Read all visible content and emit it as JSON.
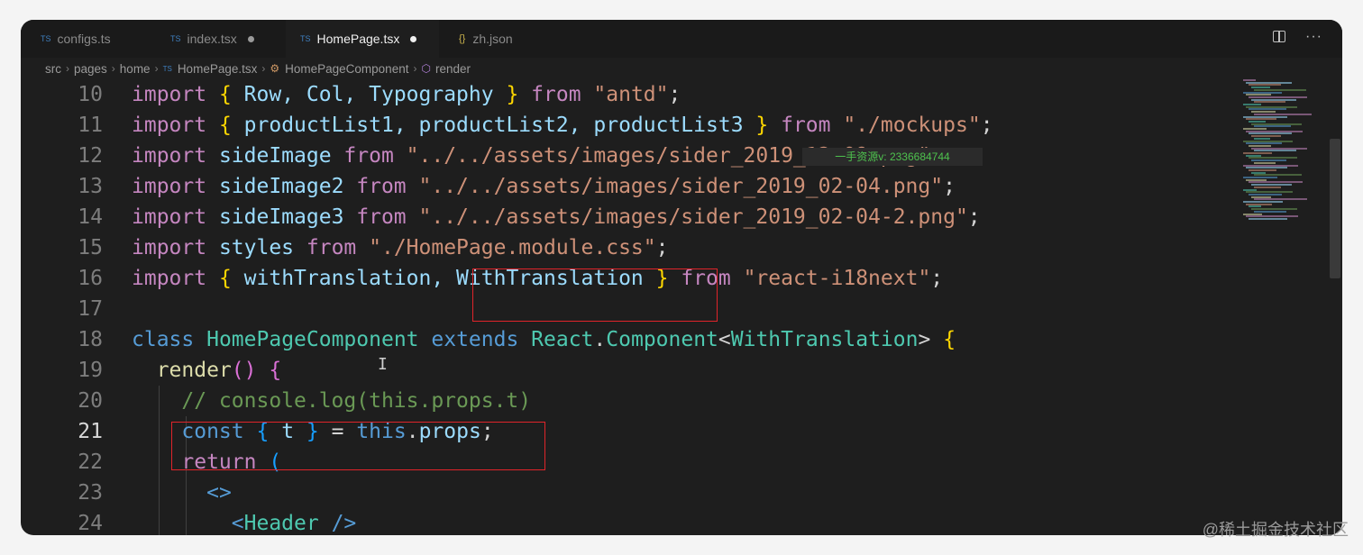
{
  "tabs": [
    {
      "label": "configs.ts",
      "badge": "TS",
      "modified": false,
      "active": false
    },
    {
      "label": "index.tsx",
      "badge": "TS",
      "modified": true,
      "active": false
    },
    {
      "label": "HomePage.tsx",
      "badge": "TS",
      "modified": true,
      "active": true
    },
    {
      "label": "zh.json",
      "badge": "{}",
      "modified": false,
      "active": false
    }
  ],
  "breadcrumb": {
    "items": [
      "src",
      "pages",
      "home",
      "HomePage.tsx",
      "HomePageComponent",
      "render"
    ],
    "file_badge": "TS"
  },
  "tooltip": "一手资源v: 2336684744",
  "watermark": "@稀土掘金技术社区",
  "editor": {
    "current_line": "21",
    "lines": [
      {
        "n": "10",
        "segments": [
          [
            "kw",
            "import"
          ],
          [
            "punc",
            " "
          ],
          [
            "br1",
            "{"
          ],
          [
            "var",
            " Row, Col, Typography "
          ],
          [
            "br1",
            "}"
          ],
          [
            "kw",
            " from "
          ],
          [
            "str",
            "\"antd\""
          ],
          [
            "punc",
            ";"
          ]
        ]
      },
      {
        "n": "11",
        "segments": [
          [
            "kw",
            "import"
          ],
          [
            "punc",
            " "
          ],
          [
            "br1",
            "{"
          ],
          [
            "var",
            " productList1, productList2, productList3 "
          ],
          [
            "br1",
            "}"
          ],
          [
            "kw",
            " from "
          ],
          [
            "str",
            "\"./mockups\""
          ],
          [
            "punc",
            ";"
          ]
        ]
      },
      {
        "n": "12",
        "segments": [
          [
            "kw",
            "import"
          ],
          [
            "var",
            " sideImage "
          ],
          [
            "kw",
            "from "
          ],
          [
            "str",
            "\"../../assets/images/sider_2019_12-09.png\""
          ],
          [
            "punc",
            ";"
          ]
        ]
      },
      {
        "n": "13",
        "segments": [
          [
            "kw",
            "import"
          ],
          [
            "var",
            " sideImage2 "
          ],
          [
            "kw",
            "from "
          ],
          [
            "str",
            "\"../../assets/images/sider_2019_02-04.png\""
          ],
          [
            "punc",
            ";"
          ]
        ]
      },
      {
        "n": "14",
        "segments": [
          [
            "kw",
            "import"
          ],
          [
            "var",
            " sideImage3 "
          ],
          [
            "kw",
            "from "
          ],
          [
            "str",
            "\"../../assets/images/sider_2019_02-04-2.png\""
          ],
          [
            "punc",
            ";"
          ]
        ]
      },
      {
        "n": "15",
        "segments": [
          [
            "kw",
            "import"
          ],
          [
            "var",
            " styles "
          ],
          [
            "kw",
            "from "
          ],
          [
            "str",
            "\"./HomePage.module.css\""
          ],
          [
            "punc",
            ";"
          ]
        ]
      },
      {
        "n": "16",
        "segments": [
          [
            "kw",
            "import"
          ],
          [
            "punc",
            " "
          ],
          [
            "br1",
            "{"
          ],
          [
            "var",
            " withTranslation, WithTranslation "
          ],
          [
            "br1",
            "}"
          ],
          [
            "kw",
            " from "
          ],
          [
            "str",
            "\"react-i18next\""
          ],
          [
            "punc",
            ";"
          ]
        ]
      },
      {
        "n": "17",
        "segments": []
      },
      {
        "n": "18",
        "segments": [
          [
            "kb",
            "class"
          ],
          [
            "punc",
            " "
          ],
          [
            "cls",
            "HomePageComponent"
          ],
          [
            "punc",
            " "
          ],
          [
            "kb",
            "extends"
          ],
          [
            "punc",
            " "
          ],
          [
            "cls",
            "React"
          ],
          [
            "punc",
            "."
          ],
          [
            "cls",
            "Component"
          ],
          [
            "punc",
            "<"
          ],
          [
            "cls",
            "WithTranslation"
          ],
          [
            "punc",
            "> "
          ],
          [
            "br1",
            "{"
          ]
        ]
      },
      {
        "n": "19",
        "segments": [
          [
            "punc",
            "  "
          ],
          [
            "fn",
            "render"
          ],
          [
            "br2",
            "()"
          ],
          [
            "punc",
            " "
          ],
          [
            "br2",
            "{"
          ]
        ]
      },
      {
        "n": "20",
        "segments": [
          [
            "punc",
            "    "
          ],
          [
            "cm",
            "// console.log(this.props.t)"
          ]
        ]
      },
      {
        "n": "21",
        "segments": [
          [
            "punc",
            "    "
          ],
          [
            "kb",
            "const"
          ],
          [
            "punc",
            " "
          ],
          [
            "br3",
            "{"
          ],
          [
            "var",
            " t "
          ],
          [
            "br3",
            "}"
          ],
          [
            "punc",
            " = "
          ],
          [
            "kb",
            "this"
          ],
          [
            "punc",
            "."
          ],
          [
            "var",
            "props"
          ],
          [
            "punc",
            ";"
          ]
        ]
      },
      {
        "n": "22",
        "segments": [
          [
            "punc",
            "    "
          ],
          [
            "kw",
            "return"
          ],
          [
            "punc",
            " "
          ],
          [
            "br3",
            "("
          ]
        ]
      },
      {
        "n": "23",
        "segments": [
          [
            "punc",
            "      "
          ],
          [
            "kb",
            "<>"
          ]
        ]
      },
      {
        "n": "24",
        "segments": [
          [
            "punc",
            "        "
          ],
          [
            "kb",
            "<"
          ],
          [
            "cls",
            "Header"
          ],
          [
            "kb",
            " />"
          ]
        ]
      }
    ]
  }
}
